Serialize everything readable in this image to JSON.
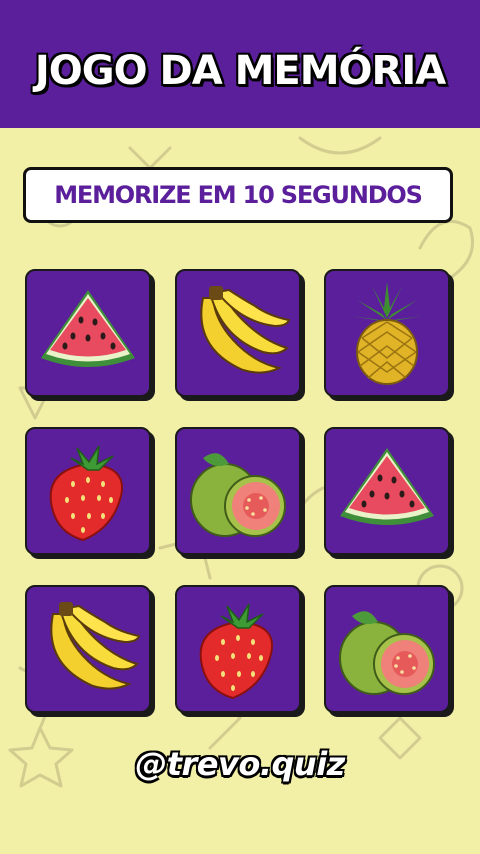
{
  "header": {
    "title": "JOGO DA MEMÓRIA"
  },
  "banner": {
    "text": "MEMORIZE EM 10 SEGUNDOS"
  },
  "cards": [
    {
      "fruit": "watermelon-icon"
    },
    {
      "fruit": "banana-icon"
    },
    {
      "fruit": "pineapple-icon"
    },
    {
      "fruit": "strawberry-icon"
    },
    {
      "fruit": "guava-icon"
    },
    {
      "fruit": "watermelon-icon"
    },
    {
      "fruit": "banana-icon"
    },
    {
      "fruit": "strawberry-icon"
    },
    {
      "fruit": "guava-icon"
    }
  ],
  "footer": {
    "handle": "@trevo.quiz"
  },
  "colors": {
    "header": "#5b1f9c",
    "background": "#f2efa6",
    "card": "#5b1f9c"
  }
}
